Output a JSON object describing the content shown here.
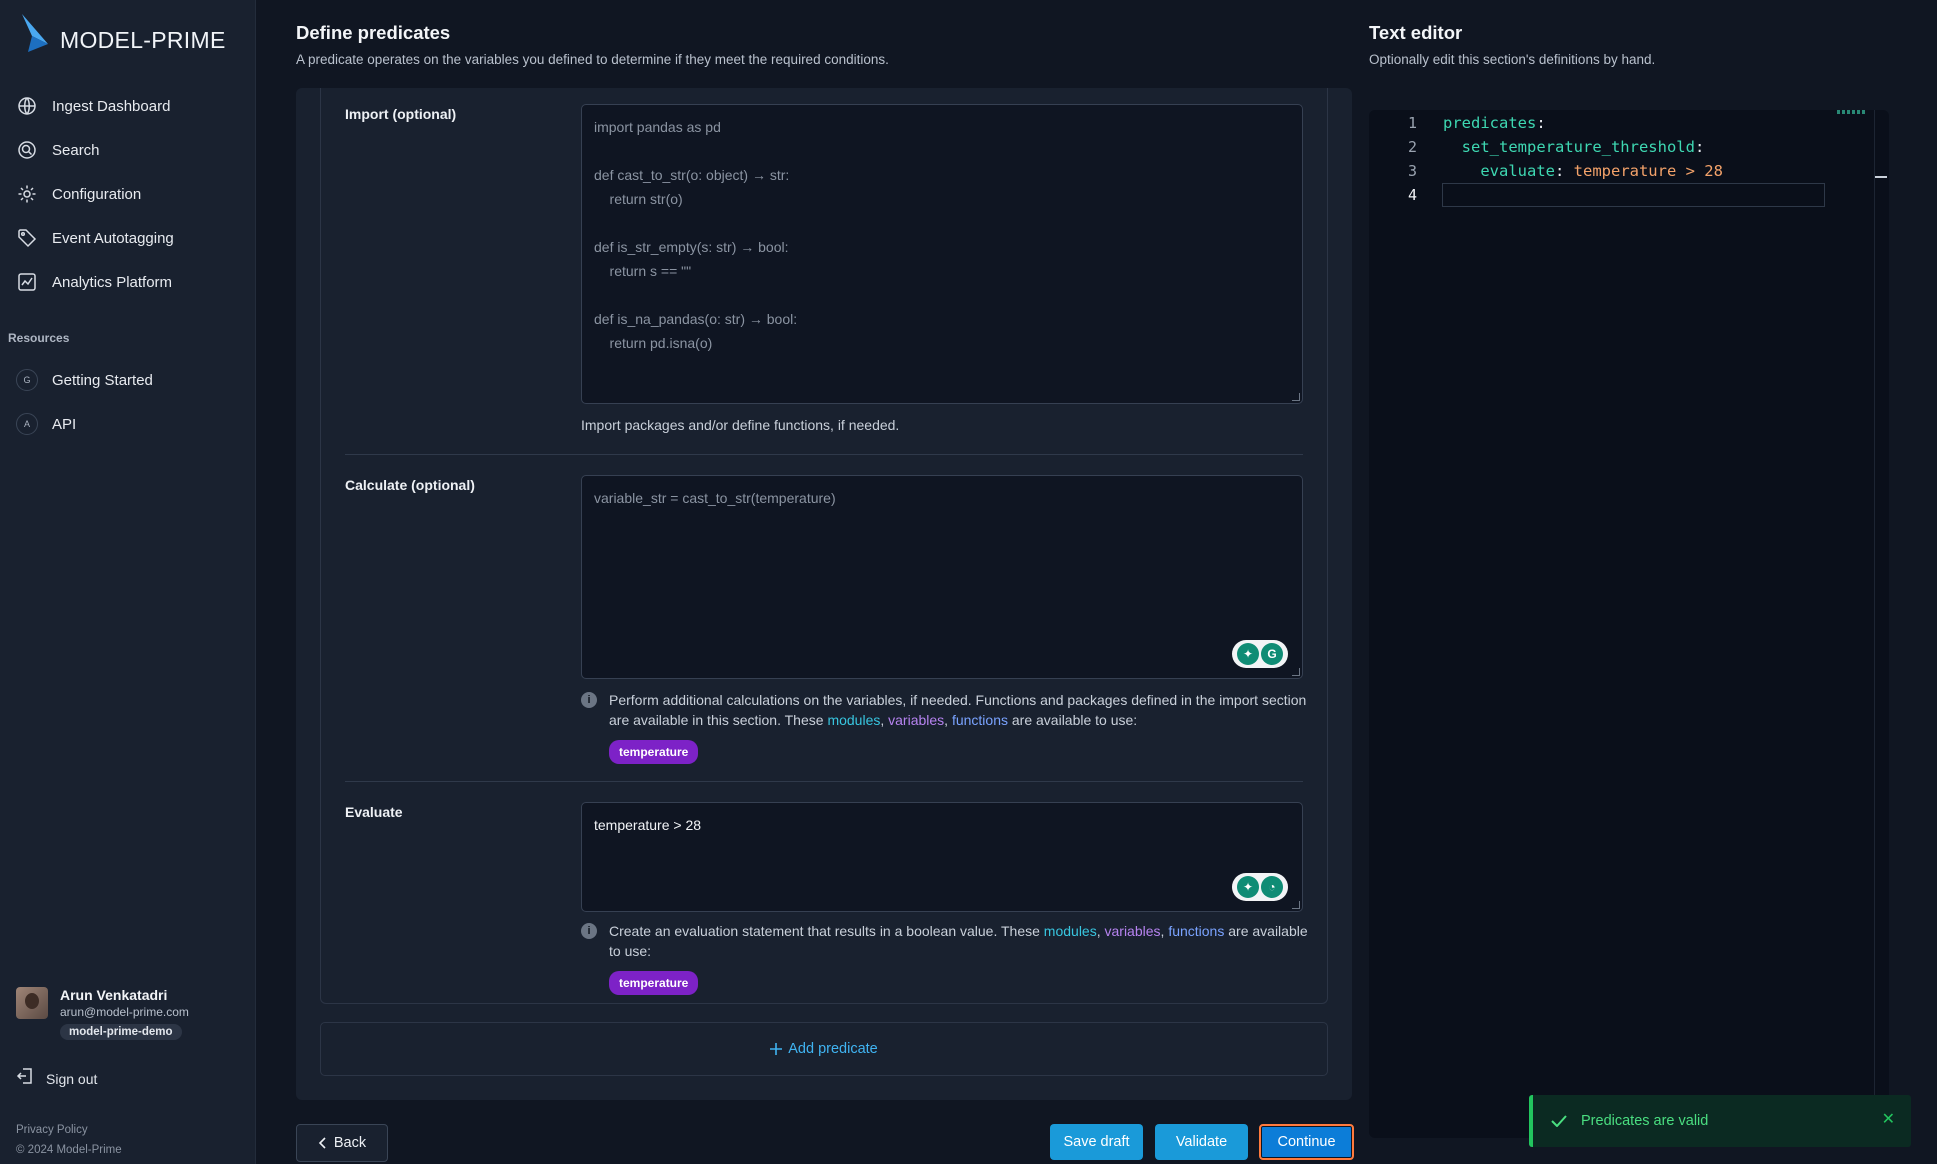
{
  "app": {
    "name": "MODEL-PRIME"
  },
  "sidebar": {
    "nav": [
      {
        "label": "Ingest Dashboard",
        "icon": "globe-icon"
      },
      {
        "label": "Search",
        "icon": "search-icon"
      },
      {
        "label": "Configuration",
        "icon": "gear-icon"
      },
      {
        "label": "Event Autotagging",
        "icon": "tag-icon"
      },
      {
        "label": "Analytics Platform",
        "icon": "chart-icon"
      }
    ],
    "resources_title": "Resources",
    "resources": [
      {
        "badge": "G",
        "label": "Getting Started"
      },
      {
        "badge": "A",
        "label": "API"
      }
    ],
    "user": {
      "name": "Arun Venkatadri",
      "email": "arun@model-prime.com",
      "org": "model-prime-demo"
    },
    "signout": "Sign out",
    "privacy": "Privacy Policy",
    "copyright": "© 2024 Model-Prime"
  },
  "main": {
    "title": "Define predicates",
    "subtitle": "A predicate operates on the variables you defined to determine if they meet the required conditions.",
    "import": {
      "label": "Import (optional)",
      "placeholder_lines": [
        "import pandas as pd",
        "",
        "def cast_to_str(o: object) → str:",
        "    return str(o)",
        "",
        "def is_str_empty(s: str) → bool:",
        "    return s == \"\"",
        "",
        "def is_na_pandas(o: str) → bool:",
        "    return pd.isna(o)"
      ],
      "help": "Import packages and/or define functions, if needed."
    },
    "calculate": {
      "label": "Calculate (optional)",
      "placeholder": "variable_str = cast_to_str(temperature)",
      "help_prefix": "Perform additional calculations on the variables, if needed. Functions and packages defined in the import section are available in this section. These",
      "help_suffix": "are available to use:",
      "modules": "modules",
      "variables": "variables",
      "functions": "functions",
      "tag": "temperature"
    },
    "evaluate": {
      "label": "Evaluate",
      "value": "temperature > 28",
      "help_prefix": "Create an evaluation statement that results in a boolean value. These",
      "help_suffix": "are available to use:",
      "modules": "modules",
      "variables": "variables",
      "functions": "functions",
      "tag": "temperature"
    },
    "add_predicate": "Add predicate",
    "buttons": {
      "back": "Back",
      "save": "Save draft",
      "validate": "Validate",
      "continue": "Continue"
    }
  },
  "editor": {
    "title": "Text editor",
    "subtitle": "Optionally edit this section's definitions by hand.",
    "line_numbers": [
      "1",
      "2",
      "3",
      "4"
    ],
    "line1_key": "predicates",
    "line2_key": "set_temperature_threshold",
    "line3_key": "evaluate",
    "line3_value": "temperature > 28"
  },
  "toast": {
    "message": "Predicates are valid"
  },
  "colors": {
    "accent": "#1a9ad9",
    "success": "#22c55e",
    "tag": "#7d22c7"
  }
}
